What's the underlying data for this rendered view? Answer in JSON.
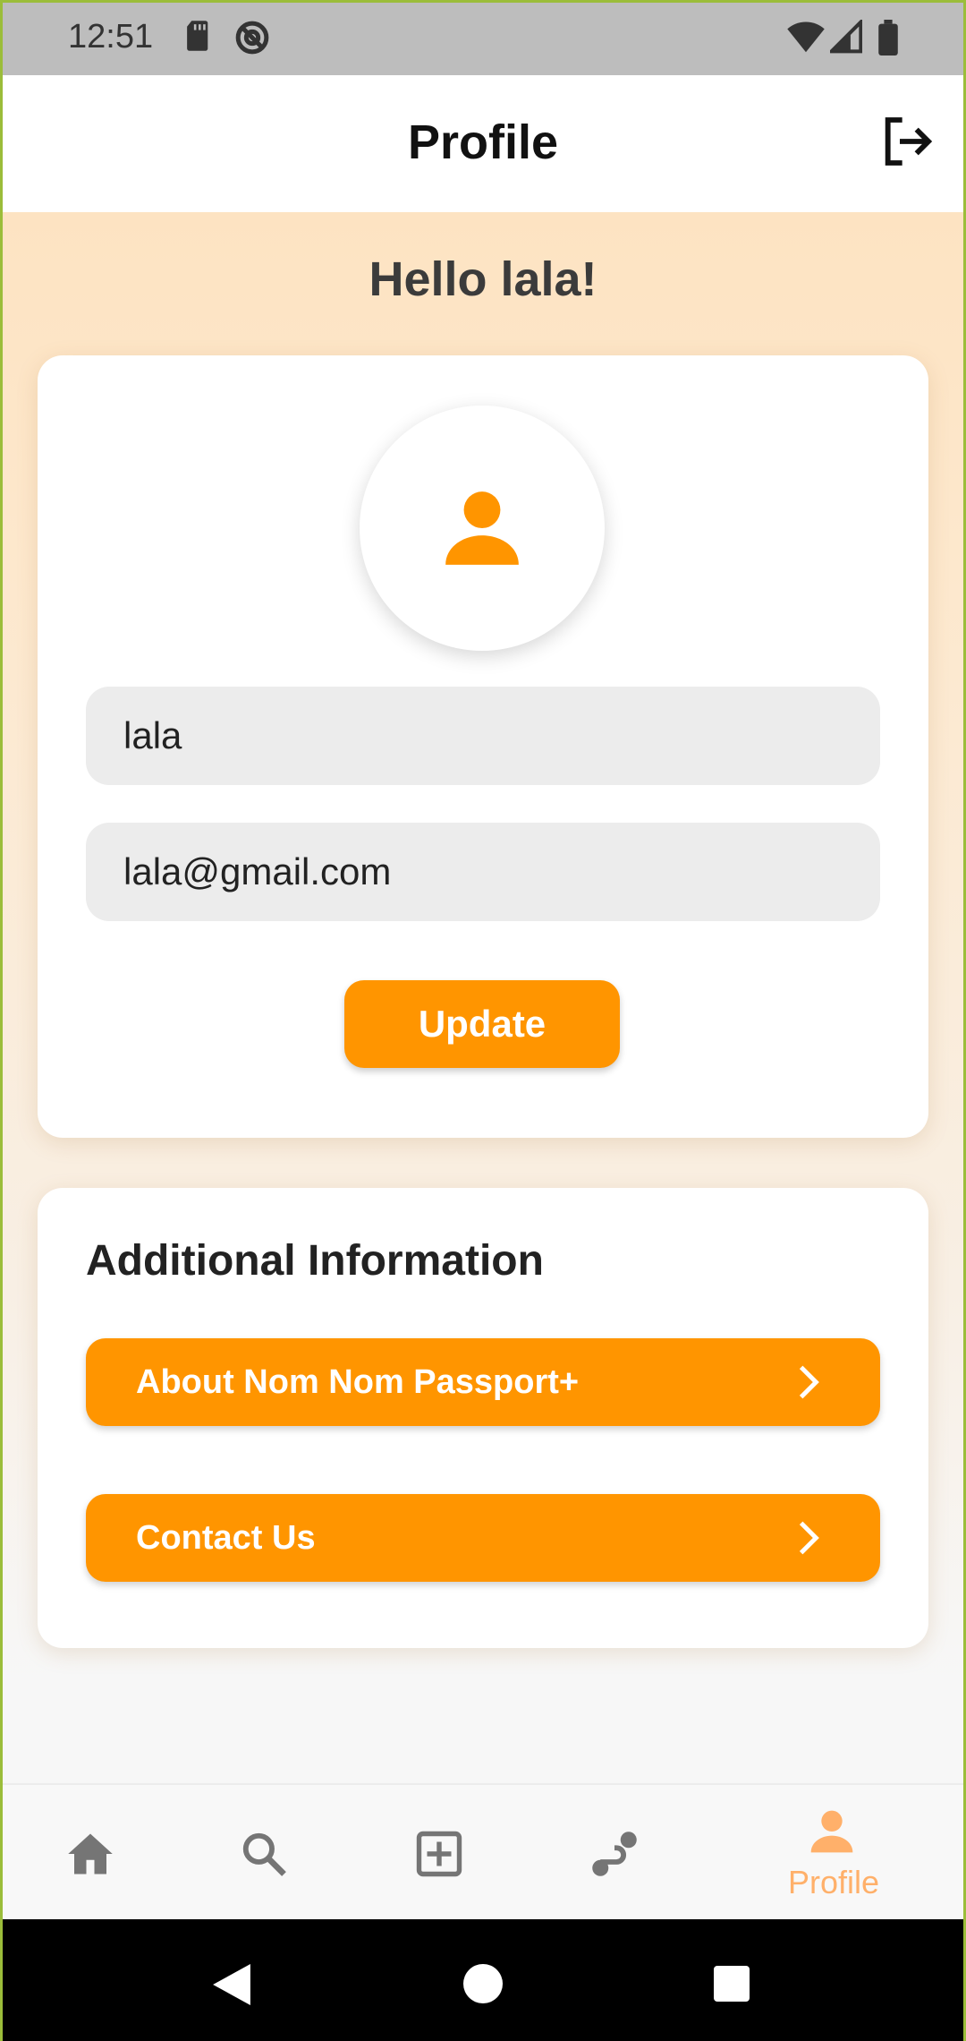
{
  "status_bar": {
    "time": "12:51",
    "icons": [
      "sd-card-icon",
      "do-not-disturb-icon",
      "wifi-icon",
      "signal-icon",
      "battery-icon"
    ]
  },
  "app_bar": {
    "title": "Profile",
    "logout_icon": "logout-icon"
  },
  "greeting": "Hello lala!",
  "profile_card": {
    "avatar_icon": "person-icon",
    "name_value": "lala",
    "email_value": "lala@gmail.com",
    "update_label": "Update"
  },
  "additional_info": {
    "title": "Additional Information",
    "items": [
      {
        "label": "About Nom Nom Passport+",
        "icon": "chevron-right-icon"
      },
      {
        "label": "Contact Us",
        "icon": "chevron-right-icon"
      }
    ]
  },
  "bottom_nav": {
    "items": [
      {
        "icon": "home-icon",
        "label": ""
      },
      {
        "icon": "search-icon",
        "label": ""
      },
      {
        "icon": "add-box-icon",
        "label": ""
      },
      {
        "icon": "route-icon",
        "label": ""
      },
      {
        "icon": "person-icon",
        "label": "Profile"
      }
    ]
  },
  "colors": {
    "accent": "#ff9500",
    "background_tint": "#fde3c2",
    "active_nav": "#ffb06a",
    "inactive_nav": "#757575"
  }
}
